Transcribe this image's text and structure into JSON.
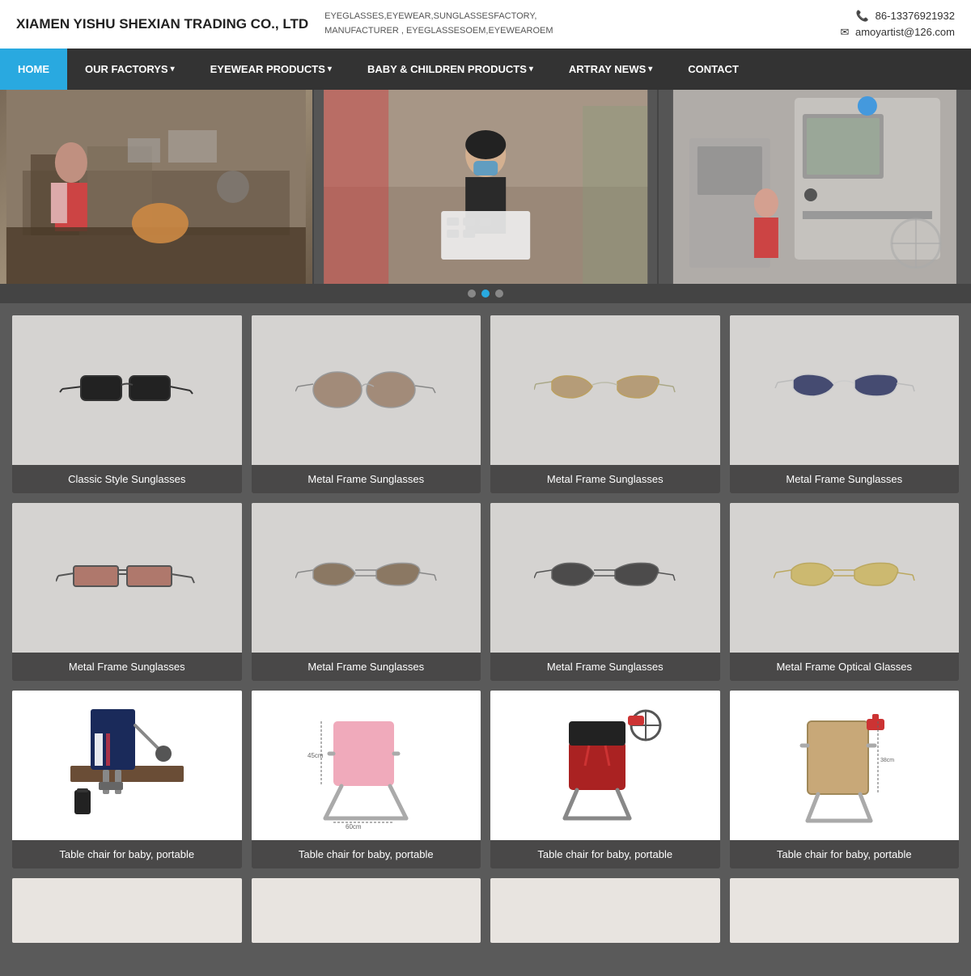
{
  "header": {
    "company_name": "XIAMEN YISHU SHEXIAN TRADING CO., LTD",
    "tagline_line1": "EYEGLASSES,EYEWEAR,SUNGLASSESFACTORY,",
    "tagline_line2": "MANUFACTURER , EYEGLASSESOEM,EYEWEAROEM",
    "phone": "86-13376921932",
    "email": "amoyartist@126.com"
  },
  "nav": {
    "items": [
      {
        "label": "HOME",
        "active": true
      },
      {
        "label": "OUR FACTORYS ▾",
        "active": false
      },
      {
        "label": "EYEWEAR PRODUCTS ▾",
        "active": false
      },
      {
        "label": "BABY & CHILDREN PRODUCTS ▾",
        "active": false
      },
      {
        "label": "ARTRAY NEWS ▾",
        "active": false
      },
      {
        "label": "CONTACT",
        "active": false
      }
    ]
  },
  "products": [
    {
      "id": 1,
      "label": "Classic Style Sunglasses",
      "type": "sunglasses-classic"
    },
    {
      "id": 2,
      "label": "Metal Frame Sunglasses",
      "type": "sunglasses-metal-brown"
    },
    {
      "id": 3,
      "label": "Metal Frame Sunglasses",
      "type": "sunglasses-aviator-gold"
    },
    {
      "id": 4,
      "label": "Metal Frame Sunglasses",
      "type": "sunglasses-aviator-dark"
    },
    {
      "id": 5,
      "label": "Metal Frame Sunglasses",
      "type": "sunglasses-metal-red"
    },
    {
      "id": 6,
      "label": "Metal Frame Sunglasses",
      "type": "sunglasses-aviator-brown"
    },
    {
      "id": 7,
      "label": "Metal Frame Sunglasses",
      "type": "sunglasses-aviator-black"
    },
    {
      "id": 8,
      "label": "Metal Frame Optical Glasses",
      "type": "sunglasses-optical-yellow"
    },
    {
      "id": 9,
      "label": "Table chair for baby, portable",
      "type": "baby-chair-1"
    },
    {
      "id": 10,
      "label": "Table chair for baby, portable",
      "type": "baby-chair-2"
    },
    {
      "id": 11,
      "label": "Table chair for baby, portable",
      "type": "baby-chair-3"
    },
    {
      "id": 12,
      "label": "Table chair for baby, portable",
      "type": "baby-chair-4"
    }
  ]
}
